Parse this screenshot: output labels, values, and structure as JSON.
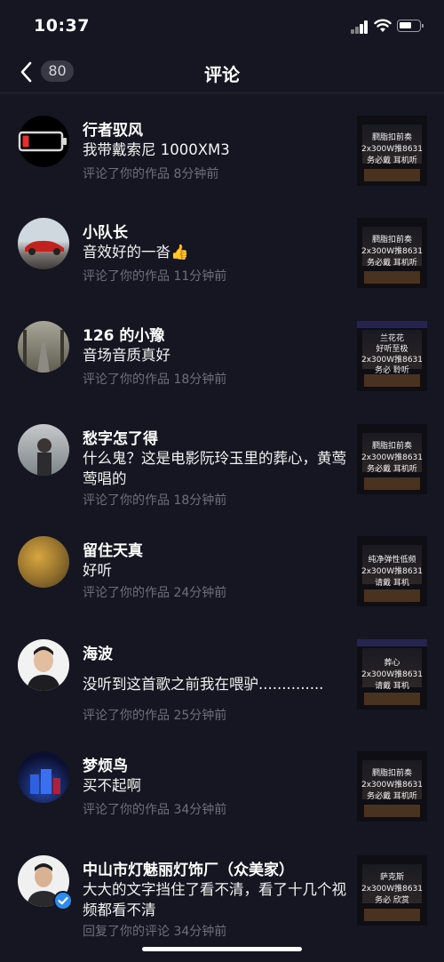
{
  "status": {
    "time": "10:37"
  },
  "nav": {
    "back_count": "80",
    "title": "评论"
  },
  "comments": [
    {
      "name": "行者驭风",
      "text": "我带戴索尼 1000XM3",
      "meta": "评论了你的作品  8分钟前",
      "thumb": [
        "膶脂扣前奏",
        "2x300W推8631",
        "务必戴   耳机听"
      ]
    },
    {
      "name": "小队长",
      "text": "音效好的一沓👍",
      "meta": "评论了你的作品  11分钟前",
      "thumb": [
        "膶脂扣前奏",
        "2x300W推8631",
        "务必戴   耳机听"
      ]
    },
    {
      "name": "126 的小豫",
      "text": "音场音质真好",
      "meta": "评论了你的作品  18分钟前",
      "thumb": [
        "兰花花",
        "好听至极",
        "2x300W推8631",
        "务必   聆听"
      ]
    },
    {
      "name": "愁字怎了得",
      "text": "什么鬼？这是电影阮玲玉里的葬心，黄莺莺唱的",
      "meta": "评论了你的作品  18分钟前",
      "thumb": [
        "膶脂扣前奏",
        "2x300W推8631",
        "务必戴   耳机听"
      ]
    },
    {
      "name": "留住天真",
      "text": "好听",
      "meta": "评论了你的作品  24分钟前",
      "thumb": [
        "纯净弹性低频",
        "2x300W推8631",
        "请戴   耳机"
      ]
    },
    {
      "name": "海波",
      "text": "没听到这首歌之前我在喂驴..............",
      "meta": "评论了你的作品  25分钟前",
      "thumb": [
        "葬心",
        "2x300W推8631",
        "请戴   耳机"
      ]
    },
    {
      "name": "梦烦鸟",
      "text": "买不起啊",
      "meta": "评论了你的作品  34分钟前",
      "thumb": [
        "膶脂扣前奏",
        "2x300W推8631",
        "务必戴   耳机听"
      ]
    },
    {
      "name": "中山市灯魅丽灯饰厂（众美家）",
      "text": "大大的文字挡住了看不清，看了十几个视频都看不清",
      "meta": "回复了你的评论  34分钟前",
      "thumb": [
        "萨克斯",
        "2x300W推8631",
        "务必   欣赏"
      ]
    }
  ],
  "colors": {
    "background": "#161622",
    "meta_text": "#6f6f7b",
    "verified": "#2d8cf0"
  }
}
